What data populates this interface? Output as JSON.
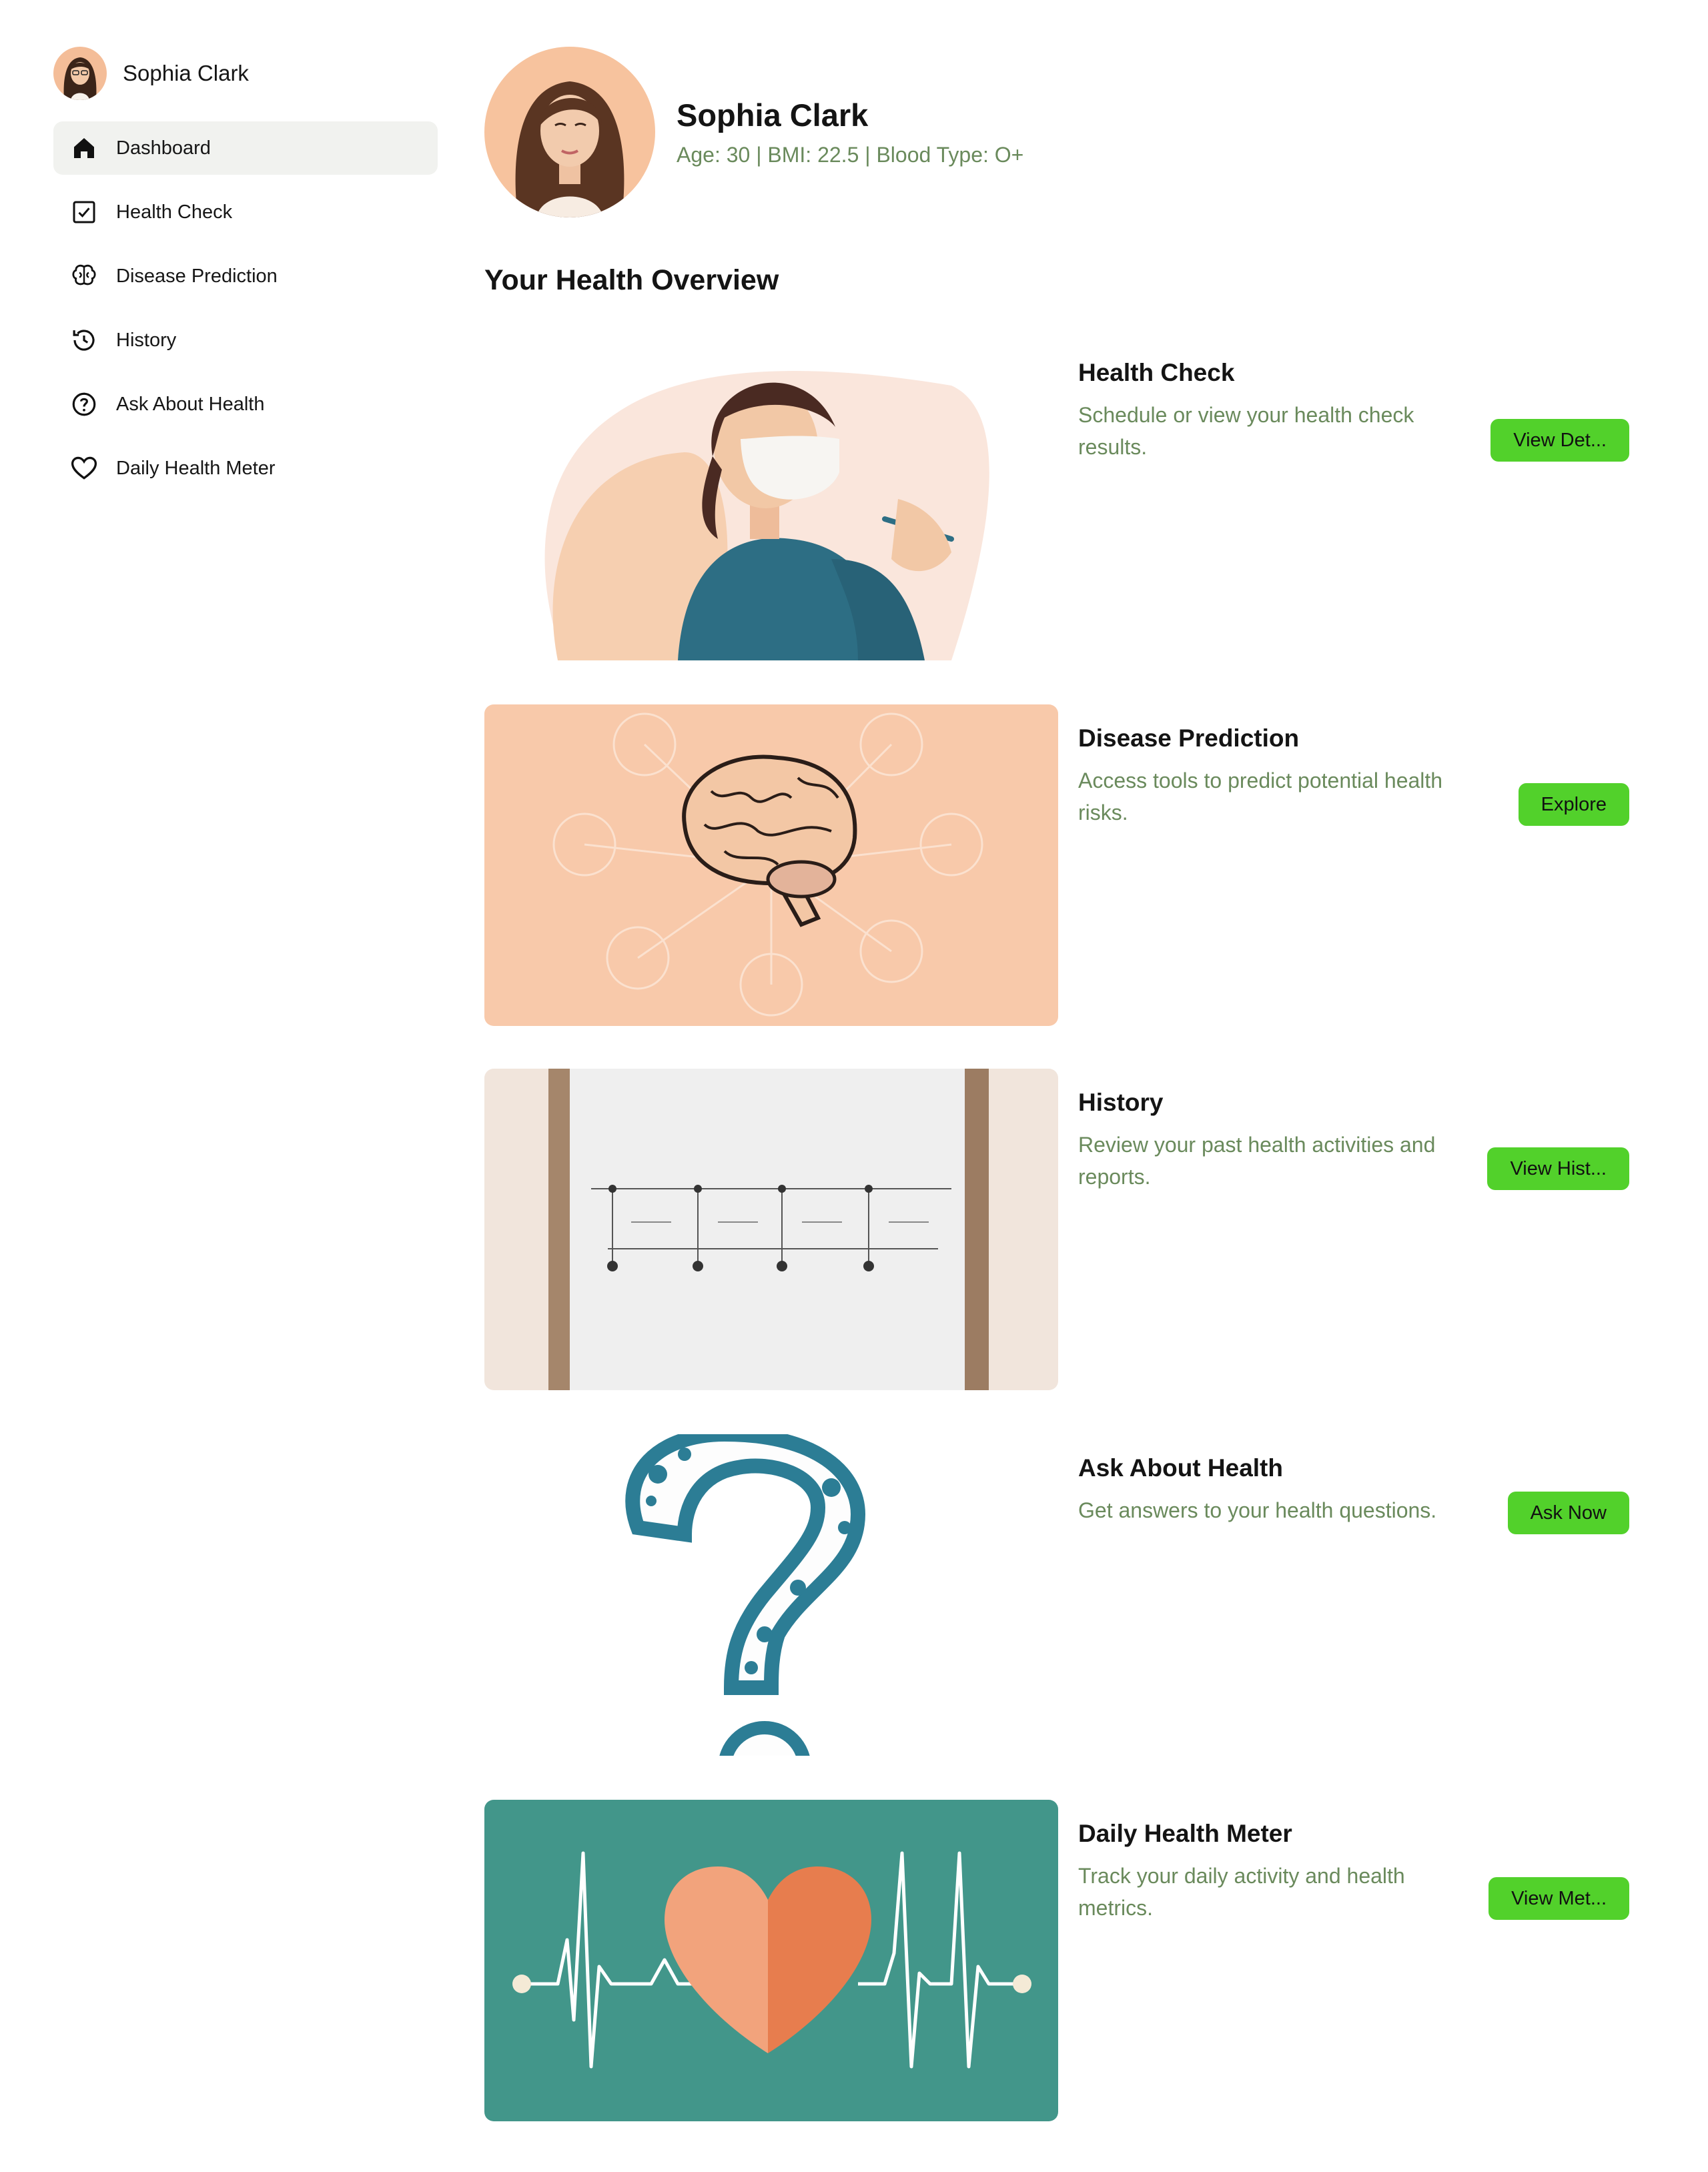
{
  "sidebar": {
    "user_name": "Sophia Clark",
    "items": [
      {
        "label": "Dashboard",
        "icon": "home-icon",
        "active": true
      },
      {
        "label": "Health Check",
        "icon": "checkbox-icon",
        "active": false
      },
      {
        "label": "Disease Prediction",
        "icon": "brain-icon",
        "active": false
      },
      {
        "label": "History",
        "icon": "history-icon",
        "active": false
      },
      {
        "label": "Ask About Health",
        "icon": "question-icon",
        "active": false
      },
      {
        "label": "Daily Health Meter",
        "icon": "heart-icon",
        "active": false
      }
    ]
  },
  "profile": {
    "name": "Sophia Clark",
    "meta": "Age: 30 | BMI: 22.5 | Blood Type: O+"
  },
  "overview": {
    "title": "Your Health Overview",
    "cards": [
      {
        "title": "Health Check",
        "description": "Schedule or view your health check results.",
        "button": "View Det..."
      },
      {
        "title": "Disease Prediction",
        "description": "Access tools to predict potential health risks.",
        "button": "Explore"
      },
      {
        "title": "History",
        "description": "Review your past health activities and reports.",
        "button": "View Hist..."
      },
      {
        "title": "Ask About Health",
        "description": "Get answers to your health questions.",
        "button": "Ask Now"
      },
      {
        "title": "Daily Health Meter",
        "description": "Track your daily activity and health metrics.",
        "button": "View Met..."
      }
    ]
  },
  "colors": {
    "accent_button": "#52d12b",
    "muted_text": "#6a8a5c",
    "active_nav_bg": "#f1f2ef"
  }
}
